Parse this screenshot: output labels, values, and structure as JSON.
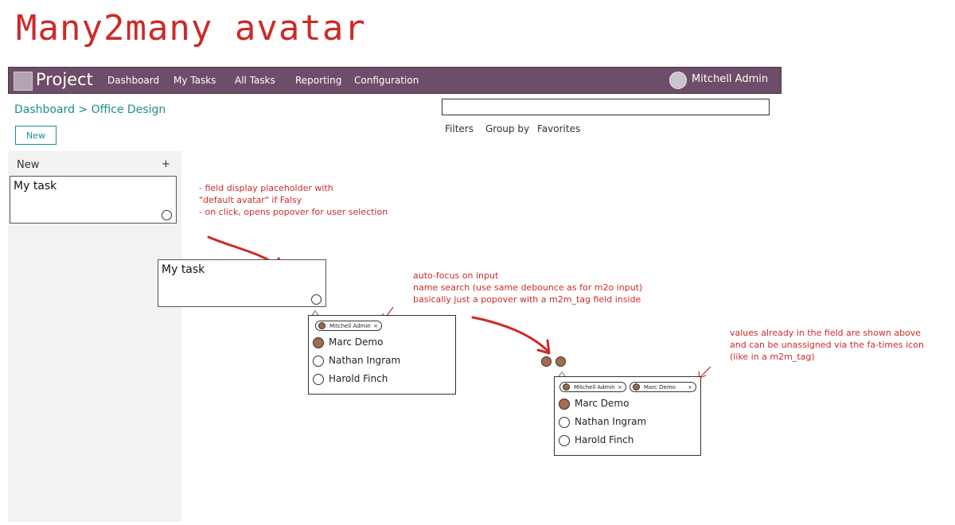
{
  "title": "Many2many avatar",
  "navbar": {
    "app_name": "Project",
    "menu": [
      "Dashboard",
      "My Tasks",
      "All Tasks",
      "Reporting",
      "Configuration"
    ],
    "user_name": "Mitchell Admin",
    "color": "#6e4d68"
  },
  "control_panel": {
    "breadcrumb": "Dashboard > Office Design",
    "new_button": "New",
    "search": {
      "value": "",
      "placeholder": ""
    },
    "search_options": [
      "Filters",
      "Group by",
      "Favorites"
    ]
  },
  "kanban": {
    "column_title": "New",
    "column_add": "+",
    "card_title": "My task"
  },
  "annotations": {
    "note1": [
      "- field display placeholder with",
      "\"default avatar\" if Falsy",
      "- on click, opens popover for user selection"
    ],
    "note2": [
      "auto-focus on input",
      "name search (use same debounce as for m2o input)",
      "basically just a popover with a m2m_tag field inside"
    ],
    "note3": [
      "values already in the field are shown above",
      " and can be unassigned via the fa-times icon",
      "(like in a m2m_tag)"
    ],
    "accent_color": "#cc2a28"
  },
  "example1": {
    "card_title": "My task",
    "tags": [
      "Mitchell Admin"
    ],
    "options": [
      {
        "name": "Marc Demo",
        "has_avatar": true
      },
      {
        "name": "Nathan Ingram",
        "has_avatar": false
      },
      {
        "name": "Harold Finch",
        "has_avatar": false
      }
    ]
  },
  "example2": {
    "tags": [
      "Mitchell Admin",
      "Marc Demo"
    ],
    "options": [
      {
        "name": "Marc Demo",
        "has_avatar": true
      },
      {
        "name": "Nathan Ingram",
        "has_avatar": false
      },
      {
        "name": "Harold Finch",
        "has_avatar": false
      }
    ]
  },
  "tag_close_symbol": "×"
}
